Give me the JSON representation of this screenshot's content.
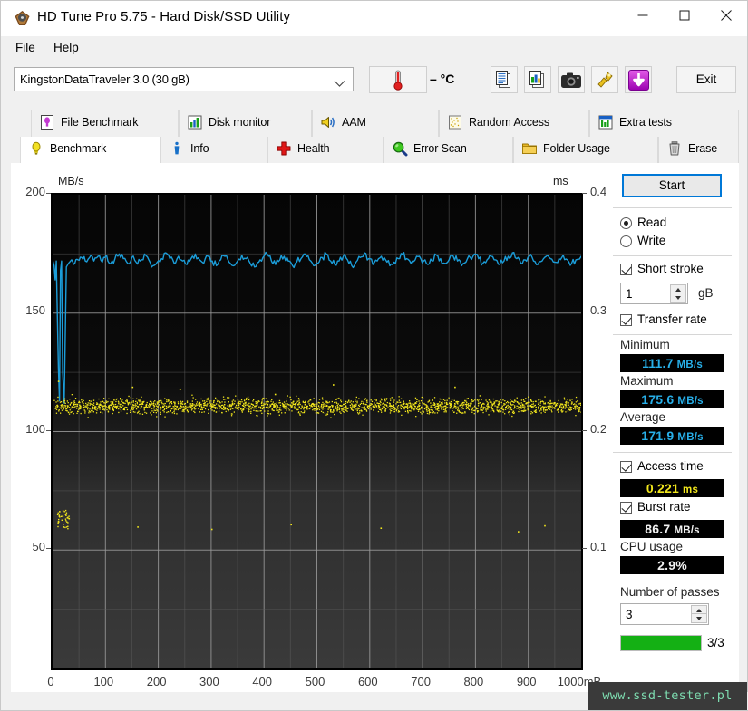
{
  "window": {
    "title": "HD Tune Pro 5.75 - Hard Disk/SSD Utility",
    "icon": "hdtune-logo-icon",
    "minimize": "—",
    "maximize": "□",
    "close": "✕"
  },
  "menu": {
    "items": [
      "File",
      "Help"
    ]
  },
  "toolbar": {
    "device": "KingstonDataTraveler 3.0 (30 gB)",
    "temperature": "– °C",
    "temp_icon": "thermometer-icon",
    "buttons": [
      {
        "name": "copy-text-button",
        "icon": "copy-text-icon"
      },
      {
        "name": "copy-image-button",
        "icon": "copy-image-icon"
      },
      {
        "name": "screenshot-button",
        "icon": "camera-icon"
      },
      {
        "name": "settings-button",
        "icon": "tools-icon"
      },
      {
        "name": "save-button",
        "icon": "purple-download-icon"
      }
    ],
    "exit_label": "Exit"
  },
  "tabs": {
    "top_row": [
      {
        "label": "File Benchmark",
        "icon": "file-benchmark-icon",
        "active": false
      },
      {
        "label": "Disk monitor",
        "icon": "bar-chart-icon",
        "active": false
      },
      {
        "label": "AAM",
        "icon": "speaker-icon",
        "active": false
      },
      {
        "label": "Random Access",
        "icon": "random-access-icon",
        "active": false
      },
      {
        "label": "Extra tests",
        "icon": "extra-tests-icon",
        "active": false
      }
    ],
    "bottom_row": [
      {
        "label": "Benchmark",
        "icon": "lightbulb-icon",
        "active": true
      },
      {
        "label": "Info",
        "icon": "info-icon",
        "active": false
      },
      {
        "label": "Health",
        "icon": "red-cross-icon",
        "active": false
      },
      {
        "label": "Error Scan",
        "icon": "magnifier-icon",
        "active": false
      },
      {
        "label": "Folder Usage",
        "icon": "folder-icon",
        "active": false
      },
      {
        "label": "Erase",
        "icon": "trash-icon",
        "active": false
      }
    ]
  },
  "panel": {
    "start_label": "Start",
    "mode": {
      "read_label": "Read",
      "write_label": "Write",
      "selected": "Read"
    },
    "short_stroke": {
      "label": "Short stroke",
      "checked": true,
      "value": "1",
      "unit": "gB"
    },
    "transfer_rate": {
      "label": "Transfer rate",
      "checked": true
    },
    "minimum": {
      "label": "Minimum",
      "value": "111.7",
      "unit": "MB/s",
      "color": "#28b0ea"
    },
    "maximum": {
      "label": "Maximum",
      "value": "175.6",
      "unit": "MB/s",
      "color": "#28b0ea"
    },
    "average": {
      "label": "Average",
      "value": "171.9",
      "unit": "MB/s",
      "color": "#28b0ea"
    },
    "access_time": {
      "label": "Access time",
      "checked": true,
      "value": "0.221",
      "unit": "ms",
      "color": "#f2e71c"
    },
    "burst_rate": {
      "label": "Burst rate",
      "checked": true,
      "value": "86.7",
      "unit": "MB/s",
      "color": "#f2f2f2"
    },
    "cpu_usage": {
      "label": "CPU usage",
      "value": "2.9%",
      "color": "#f2f2f2"
    },
    "passes": {
      "label": "Number of passes",
      "value": "3",
      "progress_text": "3/3",
      "progress_pct": 100
    }
  },
  "watermark": {
    "text": "www.ssd-tester.pl"
  },
  "chart_data": {
    "type": "line",
    "title": "",
    "xlabel": "mB",
    "ylabel": "MB/s",
    "y2label": "ms",
    "xlim": [
      0,
      1000
    ],
    "ylim": [
      0,
      200
    ],
    "y2lim": [
      0,
      0.4
    ],
    "xticks": [
      0,
      100,
      200,
      300,
      400,
      500,
      600,
      700,
      800,
      900,
      1000
    ],
    "xticklabels": [
      "0",
      "100",
      "200",
      "300",
      "400",
      "500",
      "600",
      "700",
      "800",
      "900",
      "1000mB"
    ],
    "yticks": [
      50,
      100,
      150,
      200
    ],
    "yticklabels": [
      "50",
      "100",
      "150",
      "200"
    ],
    "y2ticks": [
      0.1,
      0.2,
      0.3,
      0.4
    ],
    "y2ticklabels": [
      "0.10",
      "0.20",
      "0.30",
      "0.40"
    ],
    "grid": true,
    "background": "#0a0a0a-to-#3a3a3a gradient",
    "series": [
      {
        "name": "Transfer rate",
        "axis": "left",
        "type": "line",
        "color": "#1b9dd9",
        "unit": "MB/s",
        "summary": {
          "minimum": 111.7,
          "maximum": 175.6,
          "average": 171.9
        },
        "x": [
          0,
          3,
          5,
          7,
          9,
          11,
          13,
          15,
          17,
          19,
          22,
          26,
          30,
          36,
          42,
          48,
          55,
          62,
          70,
          78,
          86,
          94,
          102,
          110,
          118,
          126,
          134,
          142,
          150,
          158,
          166,
          174,
          182,
          190,
          198,
          206,
          214,
          222,
          230,
          238,
          246,
          254,
          262,
          270,
          278,
          286,
          294,
          302,
          310,
          318,
          326,
          334,
          342,
          350,
          358,
          366,
          374,
          382,
          390,
          398,
          406,
          414,
          422,
          430,
          438,
          446,
          454,
          462,
          470,
          478,
          486,
          494,
          502,
          510,
          518,
          526,
          534,
          542,
          550,
          558,
          566,
          574,
          582,
          590,
          598,
          606,
          614,
          622,
          630,
          638,
          646,
          654,
          662,
          670,
          678,
          686,
          694,
          702,
          710,
          718,
          726,
          734,
          742,
          750,
          758,
          766,
          774,
          782,
          790,
          798,
          806,
          814,
          822,
          830,
          838,
          846,
          854,
          862,
          870,
          878,
          886,
          894,
          902,
          910,
          918,
          926,
          934,
          942,
          950,
          958,
          966,
          974,
          982,
          990,
          1000
        ],
        "y": [
          172.5,
          170.0,
          164.0,
          172.0,
          150.0,
          127.0,
          113.0,
          168.0,
          172.0,
          125.0,
          112.0,
          169.5,
          171.0,
          172.5,
          171.0,
          172.5,
          173.5,
          172.0,
          173.5,
          172.0,
          174.0,
          171.5,
          174.5,
          171.0,
          173.0,
          175.0,
          173.0,
          171.0,
          173.5,
          171.5,
          172.0,
          175.0,
          172.5,
          170.0,
          171.5,
          173.0,
          175.5,
          173.0,
          171.0,
          174.0,
          172.0,
          170.5,
          173.0,
          175.0,
          172.5,
          171.0,
          174.0,
          172.0,
          170.0,
          172.5,
          174.0,
          171.5,
          170.0,
          172.0,
          174.5,
          173.0,
          171.0,
          169.5,
          171.5,
          173.5,
          175.0,
          172.0,
          170.5,
          172.5,
          174.0,
          172.0,
          170.0,
          171.5,
          173.0,
          175.0,
          172.5,
          170.0,
          171.0,
          173.5,
          175.0,
          172.0,
          170.5,
          172.0,
          174.0,
          172.5,
          170.0,
          171.5,
          173.5,
          175.5,
          173.0,
          170.5,
          172.0,
          174.0,
          172.5,
          170.0,
          171.5,
          173.0,
          175.0,
          173.0,
          171.0,
          172.5,
          174.0,
          172.0,
          170.5,
          172.0,
          174.5,
          173.0,
          171.0,
          172.5,
          174.0,
          172.0,
          170.0,
          171.5,
          173.5,
          175.0,
          173.0,
          171.0,
          172.5,
          174.0,
          172.5,
          170.5,
          172.0,
          174.0,
          175.5,
          173.0,
          171.0,
          172.5,
          174.0,
          172.0,
          170.5,
          172.0,
          174.0,
          173.0,
          171.5,
          173.0,
          174.5,
          172.5,
          171.0,
          172.5,
          174.0,
          173.0
        ]
      },
      {
        "name": "Access time",
        "axis": "right",
        "type": "scatter",
        "color": "#f2e71c",
        "unit": "ms",
        "average": 0.221,
        "band": {
          "center": 0.222,
          "spread": 0.01,
          "x_from": 5,
          "x_to": 1000
        },
        "outliers": [
          {
            "x": 10,
            "y": 0.243
          },
          {
            "x": 12,
            "y": 0.133
          },
          {
            "x": 18,
            "y": 0.129
          },
          {
            "x": 25,
            "y": 0.131
          },
          {
            "x": 30,
            "y": 0.127
          },
          {
            "x": 150,
            "y": 0.238
          },
          {
            "x": 160,
            "y": 0.12
          },
          {
            "x": 240,
            "y": 0.236
          },
          {
            "x": 300,
            "y": 0.118
          },
          {
            "x": 420,
            "y": 0.232
          },
          {
            "x": 450,
            "y": 0.122
          },
          {
            "x": 530,
            "y": 0.24
          },
          {
            "x": 620,
            "y": 0.119
          },
          {
            "x": 760,
            "y": 0.238
          },
          {
            "x": 880,
            "y": 0.116
          },
          {
            "x": 930,
            "y": 0.121
          }
        ]
      }
    ]
  }
}
